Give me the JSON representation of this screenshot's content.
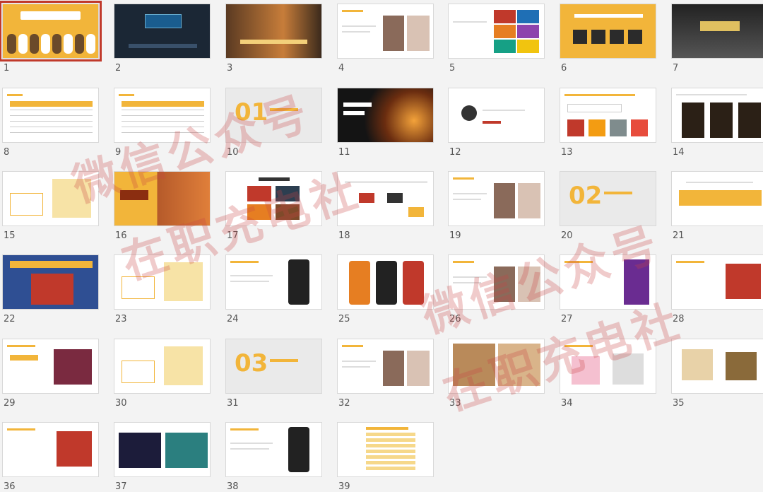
{
  "slides": [
    {
      "n": "1",
      "style": "yellow-cover",
      "selected": true
    },
    {
      "n": "2",
      "style": "dark-stage"
    },
    {
      "n": "3",
      "style": "photo-dark"
    },
    {
      "n": "4",
      "style": "white-photo"
    },
    {
      "n": "5",
      "style": "color-tiles"
    },
    {
      "n": "6",
      "style": "yellow-icons"
    },
    {
      "n": "7",
      "style": "dark-hall"
    },
    {
      "n": "8",
      "style": "table"
    },
    {
      "n": "9",
      "style": "table"
    },
    {
      "n": "10",
      "style": "section",
      "big": "01"
    },
    {
      "n": "11",
      "style": "explosion"
    },
    {
      "n": "12",
      "style": "white-logo"
    },
    {
      "n": "13",
      "style": "white-yellow"
    },
    {
      "n": "14",
      "style": "white-poster"
    },
    {
      "n": "15",
      "style": "white-cartoon"
    },
    {
      "n": "16",
      "style": "photo-orange"
    },
    {
      "n": "17",
      "style": "white-grid"
    },
    {
      "n": "18",
      "style": "flow"
    },
    {
      "n": "19",
      "style": "white-photo"
    },
    {
      "n": "20",
      "style": "section",
      "big": "02"
    },
    {
      "n": "21",
      "style": "yellow-banner"
    },
    {
      "n": "22",
      "style": "blue-game"
    },
    {
      "n": "23",
      "style": "white-cartoon"
    },
    {
      "n": "24",
      "style": "white-phone"
    },
    {
      "n": "25",
      "style": "phones"
    },
    {
      "n": "26",
      "style": "white-photo"
    },
    {
      "n": "27",
      "style": "white-purple"
    },
    {
      "n": "28",
      "style": "white-red"
    },
    {
      "n": "29",
      "style": "white-game"
    },
    {
      "n": "30",
      "style": "white-cartoon"
    },
    {
      "n": "31",
      "style": "section",
      "big": "03"
    },
    {
      "n": "32",
      "style": "white-photo"
    },
    {
      "n": "33",
      "style": "photo-toys"
    },
    {
      "n": "34",
      "style": "white-items"
    },
    {
      "n": "35",
      "style": "white-box"
    },
    {
      "n": "36",
      "style": "white-red"
    },
    {
      "n": "37",
      "style": "dark-game"
    },
    {
      "n": "38",
      "style": "white-phone"
    },
    {
      "n": "39",
      "style": "white-list"
    }
  ],
  "watermarks": [
    "微信公众号",
    "在职充电社",
    "微信公众号",
    "在职充电社"
  ],
  "colors": {
    "accent": "#f2b53a",
    "selection": "#c0392b"
  }
}
